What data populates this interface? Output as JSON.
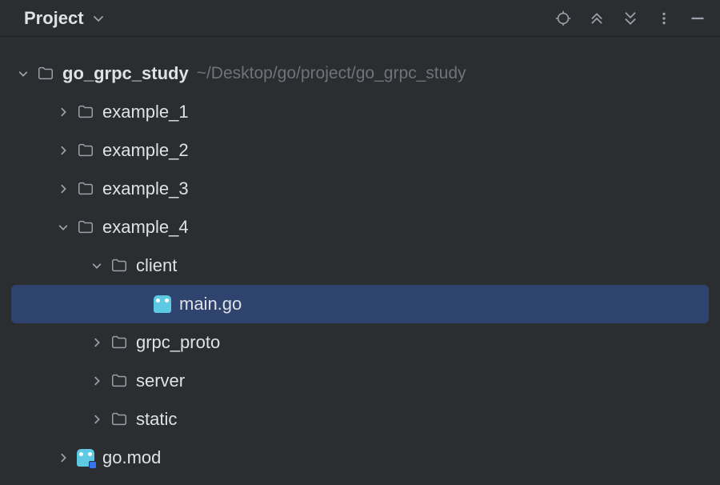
{
  "header": {
    "title": "Project"
  },
  "root": {
    "name": "go_grpc_study",
    "path": "~/Desktop/go/project/go_grpc_study"
  },
  "items": {
    "example_1": "example_1",
    "example_2": "example_2",
    "example_3": "example_3",
    "example_4": "example_4",
    "client": "client",
    "main_go": "main.go",
    "grpc_proto": "grpc_proto",
    "server": "server",
    "static": "static",
    "go_mod": "go.mod"
  }
}
